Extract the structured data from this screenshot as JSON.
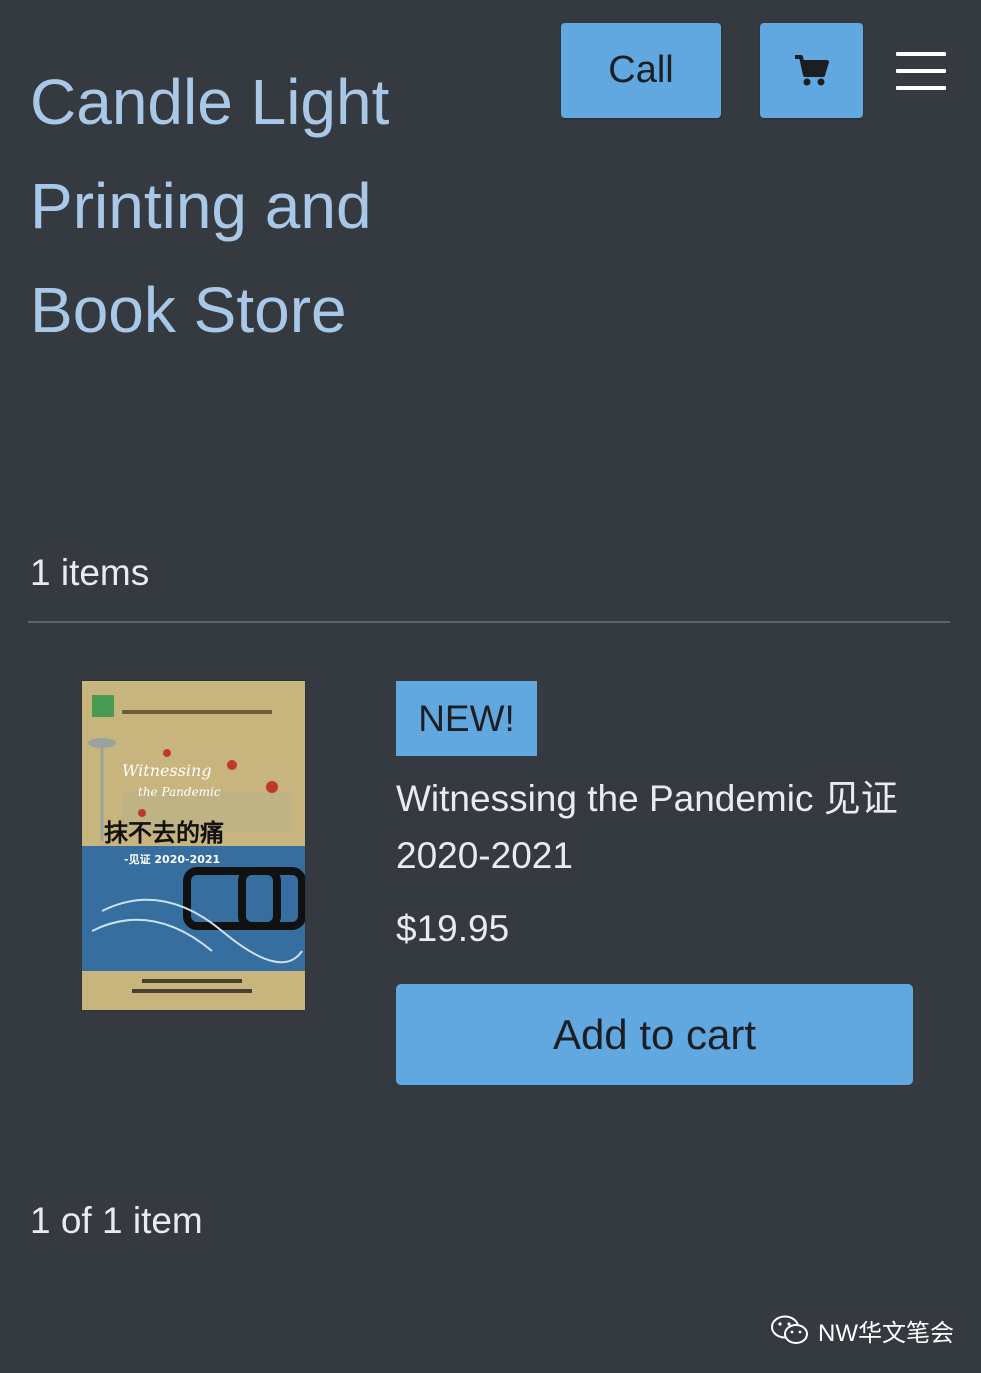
{
  "header": {
    "store_title": "Candle Light Printing and Book Store",
    "call_label": "Call",
    "cart_icon": "cart-icon",
    "menu_icon": "hamburger-menu-icon"
  },
  "listing": {
    "items_count": "1 items",
    "pagination": "1 of 1 item"
  },
  "product": {
    "badge": "NEW!",
    "name": "Witnessing the Pandemic 见证 2020-2021",
    "price": "$19.95",
    "add_to_cart_label": "Add to cart",
    "cover": {
      "title_en_1": "Witnessing",
      "title_en_2": "the Pandemic",
      "title_zh": "抹不去的痛",
      "subtitle": "-见证 2020-2021"
    }
  },
  "watermark": {
    "text": "NW华文笔会",
    "icon": "wechat-icon"
  },
  "colors": {
    "background": "#343a40",
    "accent": "#62a8e0",
    "title": "#a9c8e8"
  }
}
